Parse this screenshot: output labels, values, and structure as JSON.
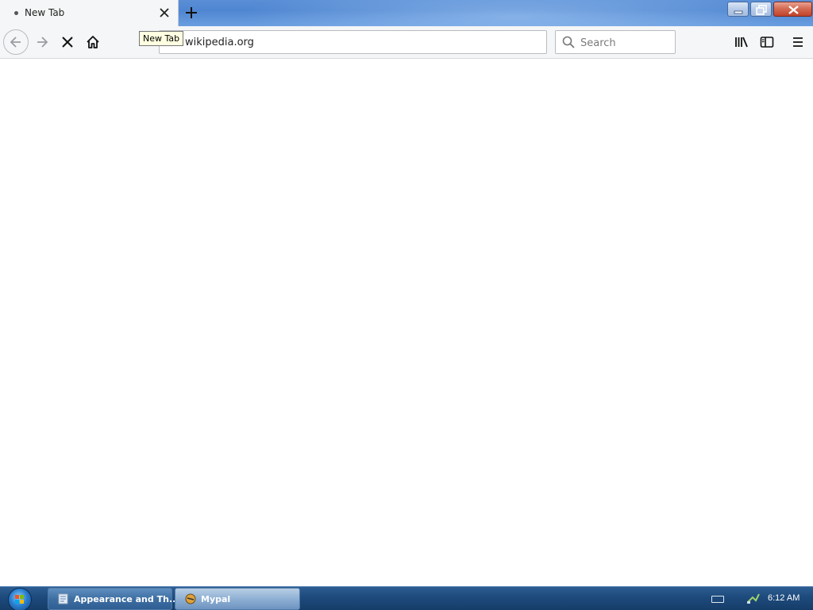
{
  "browser": {
    "tab": {
      "title": "New Tab"
    },
    "tooltip": "New Tab",
    "address_bar": {
      "value": "wikipedia.org"
    },
    "search_bar": {
      "placeholder": "Search"
    }
  },
  "taskbar": {
    "items": [
      {
        "label": "Appearance and Th...",
        "icon": "control-panel-icon"
      },
      {
        "label": "Mypal",
        "icon": "mypal-browser-icon"
      }
    ],
    "clock": "6:12 AM"
  },
  "colors": {
    "accent": "#4f86d1",
    "taskbar": "#1d4a7c",
    "close_button": "#c0432b"
  }
}
